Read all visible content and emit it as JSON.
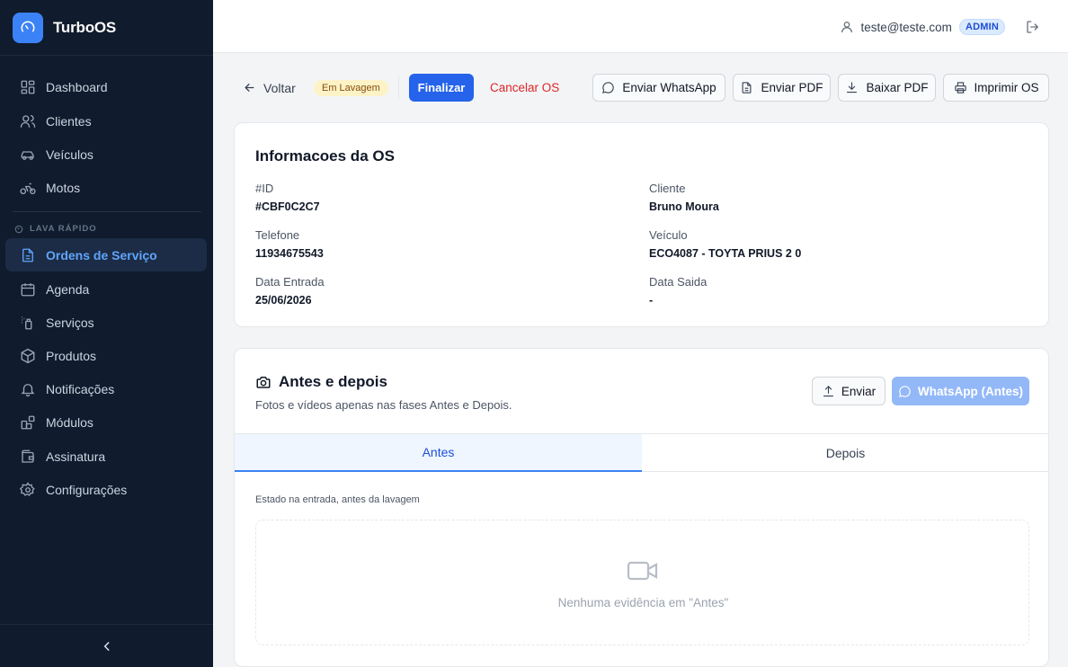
{
  "app": {
    "name": "TurboOS"
  },
  "sidebar": {
    "items": [
      {
        "label": "Dashboard",
        "icon": "dashboard-icon"
      },
      {
        "label": "Clientes",
        "icon": "users-icon"
      },
      {
        "label": "Veículos",
        "icon": "car-icon"
      },
      {
        "label": "Motos",
        "icon": "motorcycle-icon"
      }
    ],
    "section_label": "LAVA RÁPIDO",
    "section_items": [
      {
        "label": "Ordens de Serviço",
        "icon": "document-icon",
        "active": true
      },
      {
        "label": "Agenda",
        "icon": "calendar-icon"
      },
      {
        "label": "Serviços",
        "icon": "spray-icon"
      },
      {
        "label": "Produtos",
        "icon": "package-icon"
      },
      {
        "label": "Notificações",
        "icon": "bell-icon"
      },
      {
        "label": "Módulos",
        "icon": "modules-icon"
      },
      {
        "label": "Assinatura",
        "icon": "wallet-icon"
      },
      {
        "label": "Configurações",
        "icon": "gear-icon"
      }
    ]
  },
  "topbar": {
    "email": "teste@teste.com",
    "role": "ADMIN"
  },
  "actions": {
    "back": "Voltar",
    "status": "Em Lavagem",
    "finalize": "Finalizar",
    "cancel": "Cancelar OS",
    "whatsapp": "Enviar WhatsApp",
    "send_pdf": "Enviar PDF",
    "download_pdf": "Baixar PDF",
    "print": "Imprimir OS"
  },
  "info": {
    "title": "Informacoes da OS",
    "fields": {
      "id": {
        "label": "#ID",
        "value": "#CBF0C2C7"
      },
      "cliente": {
        "label": "Cliente",
        "value": "Bruno Moura"
      },
      "telefone": {
        "label": "Telefone",
        "value": "11934675543"
      },
      "veiculo": {
        "label": "Veículo",
        "value": "ECO4087 - TOYTA PRIUS 2 0"
      },
      "data_entrada": {
        "label": "Data Entrada",
        "value": "25/06/2026"
      },
      "data_saida": {
        "label": "Data Saida",
        "value": "-"
      }
    }
  },
  "media": {
    "title": "Antes e depois",
    "subtitle": "Fotos e vídeos apenas nas fases Antes e Depois.",
    "send": "Enviar",
    "whatsapp_before": "WhatsApp (Antes)",
    "tabs": [
      {
        "label": "Antes",
        "active": true
      },
      {
        "label": "Depois",
        "active": false
      }
    ],
    "caption": "Estado na entrada, antes da lavagem",
    "empty": "Nenhuma evidência em \"Antes\""
  },
  "colors": {
    "primary": "#2563eb",
    "sidebar_bg": "#101b2d",
    "danger": "#dc2626",
    "badge_bg": "#fef3c7"
  }
}
